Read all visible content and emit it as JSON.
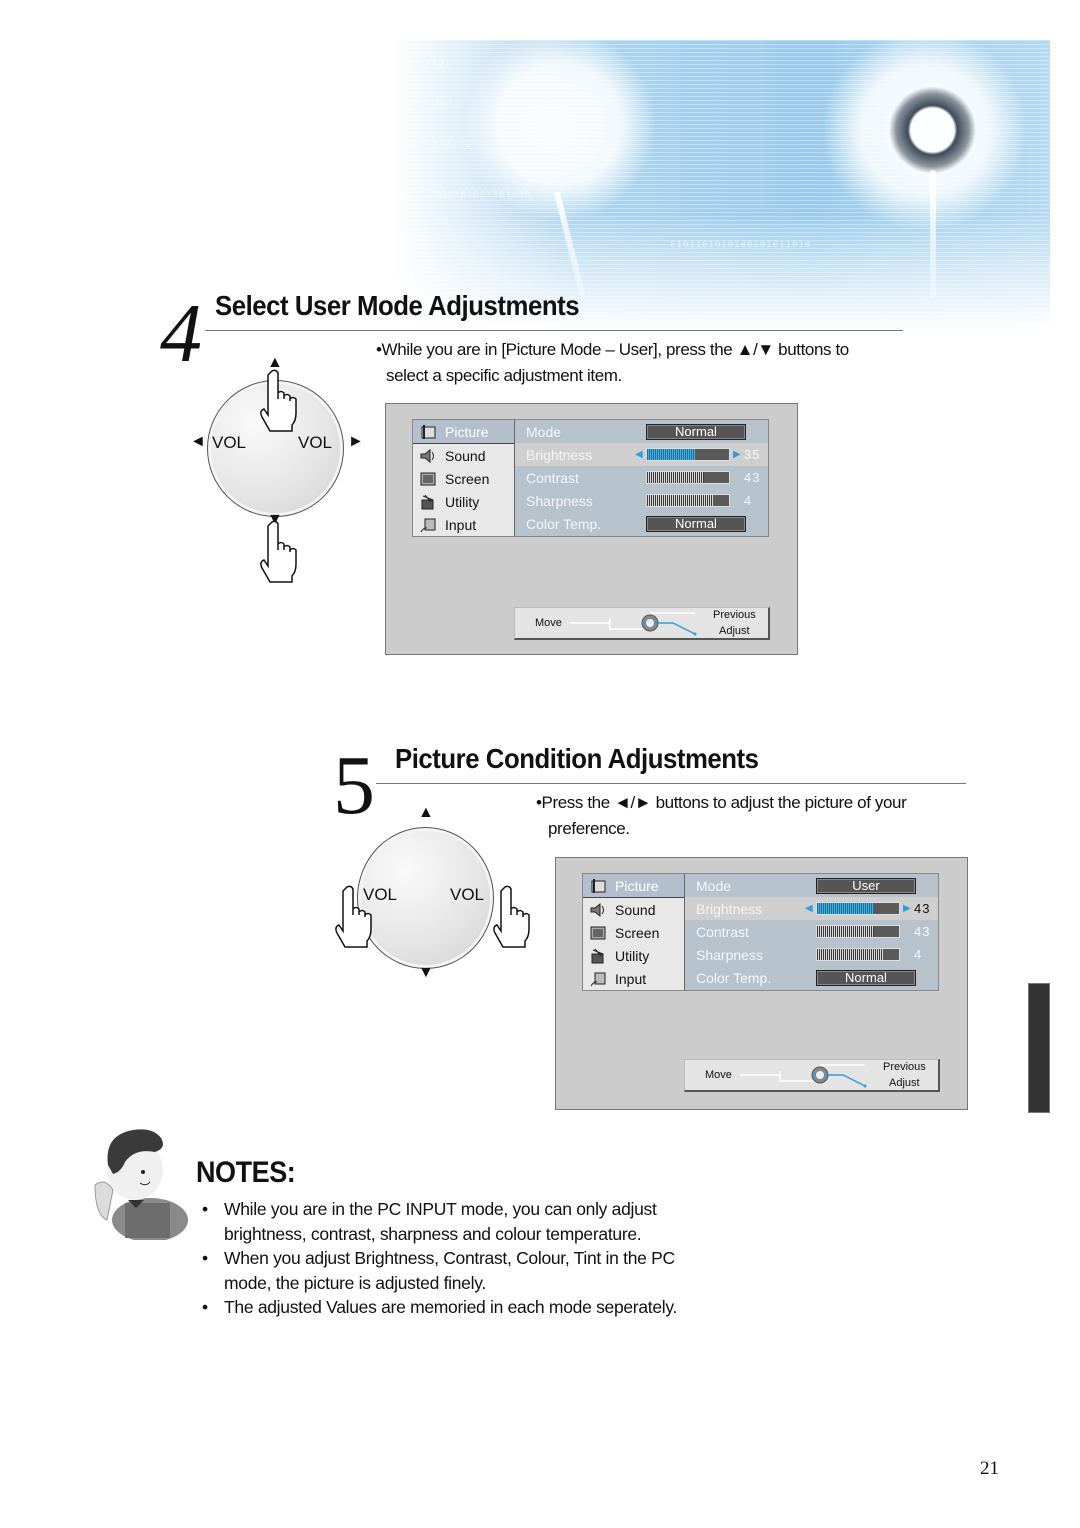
{
  "page": {
    "number": "21",
    "side_tab_color": "#333333"
  },
  "banner": {
    "description": "dandelion header image",
    "accent": "#9cccec",
    "binary_rows": [
      "0101010101001010110101",
      "1010100101011101010011",
      "0010101011010100110101",
      "1101010010101011001010",
      "0101101010100101011010"
    ]
  },
  "section4": {
    "number": "4",
    "title": "Select User Mode Adjustments",
    "instruction_line1": "•While you are in [Picture Mode – User], press the ▲/▼ buttons to",
    "instruction_line2": "select  a specific adjustment item.",
    "remote": {
      "left_label": "VOL",
      "right_label": "VOL",
      "up": "▲",
      "down": "▼",
      "left": "◄",
      "right": "►"
    },
    "osd": {
      "menu": [
        {
          "label": "Picture",
          "icon": "picture-icon",
          "active": true
        },
        {
          "label": "Sound",
          "icon": "sound-icon",
          "active": false
        },
        {
          "label": "Screen",
          "icon": "screen-icon",
          "active": false
        },
        {
          "label": "Utility",
          "icon": "utility-icon",
          "active": false
        },
        {
          "label": "Input",
          "icon": "input-icon",
          "active": false
        }
      ],
      "mode": {
        "label": "Mode",
        "value": "Normal"
      },
      "brightness": {
        "label": "Brightness",
        "value": "35",
        "fraction": 0.58
      },
      "contrast": {
        "label": "Contrast",
        "value": "43",
        "fraction": 0.7
      },
      "sharpness": {
        "label": "Sharpness",
        "value": "4",
        "fraction": 0.8
      },
      "color_temp": {
        "label": "Color Temp.",
        "value": "Normal"
      },
      "footer": {
        "move": "Move",
        "previous": "Previous",
        "adjust": "Adjust"
      }
    }
  },
  "section5": {
    "number": "5",
    "title": "Picture Condition Adjustments",
    "instruction_line1": "•Press the ◄/► buttons to adjust the picture of your",
    "instruction_line2": "preference.",
    "remote": {
      "left_label": "VOL",
      "right_label": "VOL",
      "up": "▲",
      "down": "▼"
    },
    "osd": {
      "menu": [
        {
          "label": "Picture",
          "icon": "picture-icon",
          "active": true
        },
        {
          "label": "Sound",
          "icon": "sound-icon",
          "active": false
        },
        {
          "label": "Screen",
          "icon": "screen-icon",
          "active": false
        },
        {
          "label": "Utility",
          "icon": "utility-icon",
          "active": false
        },
        {
          "label": "Input",
          "icon": "input-icon",
          "active": false
        }
      ],
      "mode": {
        "label": "Mode",
        "value": "User"
      },
      "brightness": {
        "label": "Brightness",
        "value": "43",
        "fraction": 0.7
      },
      "contrast": {
        "label": "Contrast",
        "value": "43",
        "fraction": 0.7
      },
      "sharpness": {
        "label": "Sharpness",
        "value": "4",
        "fraction": 0.8
      },
      "color_temp": {
        "label": "Color Temp.",
        "value": "Normal"
      },
      "footer": {
        "move": "Move",
        "previous": "Previous",
        "adjust": "Adjust"
      }
    }
  },
  "notes": {
    "title": "NOTES:",
    "bullet": "•",
    "items": [
      {
        "line1": "While you are in the PC INPUT mode, you can only adjust",
        "line2": "brightness, contrast, sharpness and colour temperature."
      },
      {
        "line1": "When you adjust Brightness, Contrast, Colour, Tint in the PC",
        "line2": "mode, the picture is adjusted finely."
      },
      {
        "line1": "The adjusted Values are memoried in each mode seperately.",
        "line2": ""
      }
    ]
  }
}
